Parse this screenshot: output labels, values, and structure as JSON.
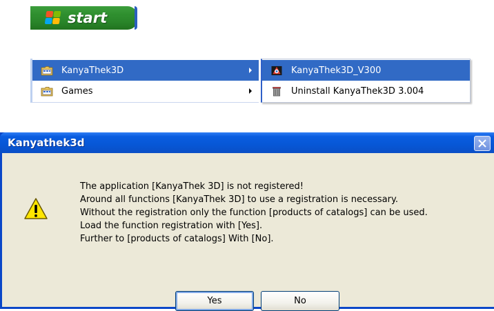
{
  "taskbar": {
    "start_label": "start"
  },
  "programs_menu": {
    "items": [
      {
        "label": "KanyaThek3D",
        "highlighted": true,
        "icon": "program-folder-icon"
      },
      {
        "label": "Games",
        "highlighted": false,
        "icon": "program-folder-icon"
      }
    ]
  },
  "submenu": {
    "items": [
      {
        "label": "KanyaThek3D_V300",
        "highlighted": true,
        "icon": "app-icon"
      },
      {
        "label": "Uninstall KanyaThek3D 3.004",
        "highlighted": false,
        "icon": "uninstall-icon"
      }
    ]
  },
  "dialog": {
    "title": "Kanyathek3d",
    "icon": "warning-icon",
    "message_lines": [
      "The application [KanyaThek 3D] is not registered!",
      "Around all functions [KanyaThek 3D] to use a registration is necessary.",
      "Without the registration only the function [products of catalogs] can be used.",
      "Load the function registration with [Yes].",
      "Further to [products of catalogs] With [No]."
    ],
    "buttons": {
      "yes": "Yes",
      "no": "No"
    }
  },
  "colors": {
    "start_green": "#2f8f2f",
    "menu_highlight": "#316ac5",
    "titlebar_blue": "#0757d6",
    "dialog_face": "#ece9d8"
  }
}
